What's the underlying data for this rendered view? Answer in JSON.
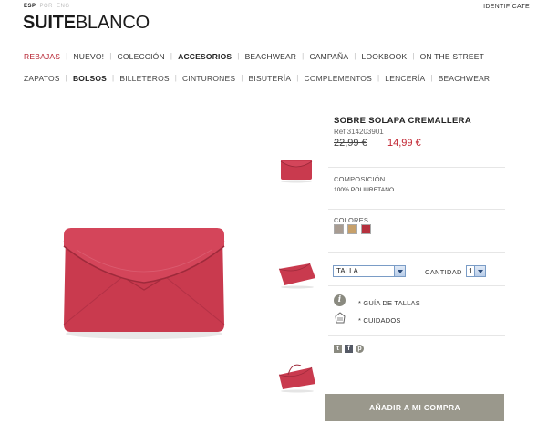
{
  "top_bar": {
    "languages": [
      "ESP",
      "POR",
      "ENG"
    ],
    "identify_link": "IDENTIFÍCATE"
  },
  "brand": {
    "logo_bold": "SUITE",
    "logo_light": "BLANCO"
  },
  "main_nav": [
    {
      "label": "REBAJAS"
    },
    {
      "label": "NUEVO!"
    },
    {
      "label": "COLECCIÓN"
    },
    {
      "label": "ACCESORIOS"
    },
    {
      "label": "BEACHWEAR"
    },
    {
      "label": "CAMPAÑA"
    },
    {
      "label": "LOOKBOOK"
    },
    {
      "label": "ON THE STREET"
    }
  ],
  "sub_nav": [
    {
      "label": "ZAPATOS"
    },
    {
      "label": "BOLSOS"
    },
    {
      "label": "BILLETEROS"
    },
    {
      "label": "CINTURONES"
    },
    {
      "label": "BISUTERÍA"
    },
    {
      "label": "COMPLEMENTOS"
    },
    {
      "label": "LENCERÍA"
    },
    {
      "label": "BEACHWEAR"
    }
  ],
  "product": {
    "title": "SOBRE SOLAPA CREMALLERA",
    "ref": "Ref.314203901",
    "old_price": "22,99 €",
    "new_price": "14,99 €",
    "composition_label": "COMPOSICIÓN",
    "composition_value": "100% POLIURETANO",
    "colors_label": "COLORES",
    "colors": [
      "#a89c92",
      "#c7a06a",
      "#b5313e"
    ],
    "size_select": "TALLA",
    "quantity_label": "CANTIDAD",
    "quantity_value": "1",
    "size_guide": "* GUÍA DE TALLAS",
    "care": "* CUIDADOS",
    "add_to_cart": "AÑADIR A MI COMPRA"
  },
  "colors": {
    "accent_red": "#c0202d",
    "bag_red": "#c93a4e",
    "button_gray": "#9a988c"
  },
  "icons": {
    "info": "info-icon",
    "care": "care-label-icon",
    "twitter": "twitter-icon",
    "facebook": "facebook-icon",
    "pinterest": "pinterest-icon",
    "dropdown": "chevron-down-icon"
  }
}
